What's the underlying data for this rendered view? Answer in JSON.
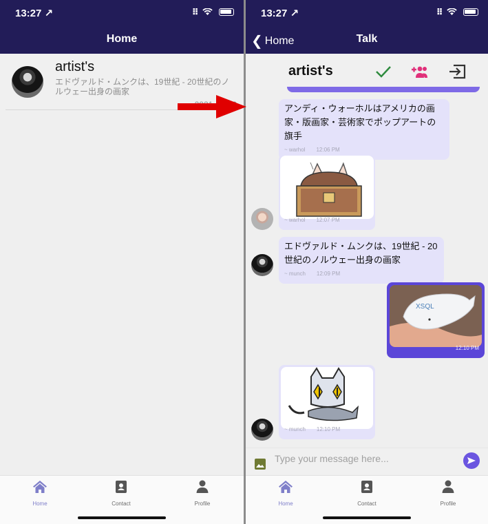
{
  "colors": {
    "navbar": "#221c58",
    "bubble": "#e4e2fa",
    "mine_bubble": "#5b46d8",
    "accent": "#7f7fc9",
    "annotation_arrow": "#e00000"
  },
  "left": {
    "status": {
      "time": "13:27 ↗"
    },
    "nav": {
      "title": "Home"
    },
    "list": [
      {
        "title": "artist's",
        "preview": "エドヴァルド・ムンクは、19世紀 - 20世紀のノルウェー出身の画家",
        "date": "2021-03-30"
      }
    ],
    "tabs": [
      {
        "label": "Home",
        "icon": "home-icon"
      },
      {
        "label": "Contact",
        "icon": "contact-book-icon"
      },
      {
        "label": "Profile",
        "icon": "person-icon"
      }
    ]
  },
  "right": {
    "status": {
      "time": "13:27 ↗"
    },
    "nav": {
      "back_label": "Home",
      "title": "Talk"
    },
    "chat_title": "artist's",
    "header_icons": [
      "checkmark-icon",
      "add-group-icon",
      "exit-icon"
    ],
    "messages": [
      {
        "type": "text",
        "text": "アンディ・ウォーホルはアメリカの画家・版画家・芸術家でポップアートの旗手",
        "author": "~ warhol",
        "time": "12:06 PM"
      },
      {
        "type": "image",
        "image": "treasure-chest-cat-sticker",
        "author": "~ warhol",
        "time": "12:07 PM"
      },
      {
        "type": "text",
        "text": "エドヴァルド・ムンクは、19世紀 - 20世紀のノルウェー出身の画家",
        "author": "~ munch",
        "time": "12:09 PM"
      },
      {
        "type": "image",
        "image": "dolphin-figure-photo",
        "author": "",
        "time": "12:10 PM",
        "mine": true
      },
      {
        "type": "image",
        "image": "cat-holding-fish-sticker",
        "author": "~ munch",
        "time": "12:10 PM"
      }
    ],
    "input": {
      "placeholder": "Type your message here..."
    },
    "tabs": [
      {
        "label": "Home",
        "icon": "home-icon"
      },
      {
        "label": "Contact",
        "icon": "contact-book-icon"
      },
      {
        "label": "Profile",
        "icon": "person-icon"
      }
    ]
  }
}
